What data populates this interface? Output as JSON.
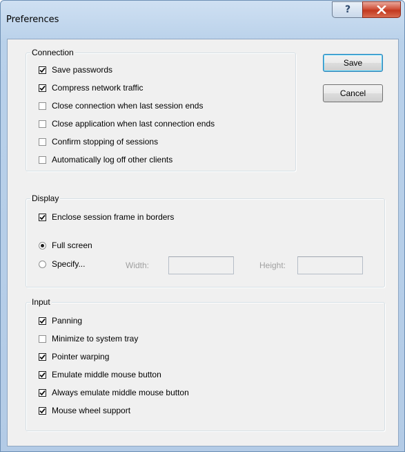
{
  "window": {
    "title": "Preferences",
    "help_glyph": "?",
    "close_glyph": "X"
  },
  "buttons": {
    "save_label": "Save",
    "cancel_label": "Cancel"
  },
  "connection": {
    "legend": "Connection",
    "items": [
      {
        "label": "Save passwords",
        "checked": true
      },
      {
        "label": "Compress network traffic",
        "checked": true
      },
      {
        "label": "Close connection when last session ends",
        "checked": false
      },
      {
        "label": "Close application when last connection ends",
        "checked": false
      },
      {
        "label": "Confirm stopping of sessions",
        "checked": false
      },
      {
        "label": "Automatically log off other clients",
        "checked": false
      }
    ]
  },
  "display": {
    "legend": "Display",
    "enclose": {
      "label": "Enclose session frame in borders",
      "checked": true
    },
    "full_screen": {
      "label": "Full screen",
      "selected": true
    },
    "specify": {
      "label": "Specify...",
      "selected": false
    },
    "width_label": "Width:",
    "width_value": "",
    "height_label": "Height:",
    "height_value": ""
  },
  "input": {
    "legend": "Input",
    "items": [
      {
        "label": "Panning",
        "checked": true
      },
      {
        "label": "Minimize to system tray",
        "checked": false
      },
      {
        "label": "Pointer warping",
        "checked": true
      },
      {
        "label": "Emulate middle mouse button",
        "checked": true
      },
      {
        "label": "Always emulate middle mouse button",
        "checked": true
      },
      {
        "label": "Mouse wheel support",
        "checked": true
      }
    ]
  },
  "colors": {
    "title_bar": "#b9d1ea",
    "client_bg": "#f0f0f0",
    "close_button": "#c7432a"
  }
}
